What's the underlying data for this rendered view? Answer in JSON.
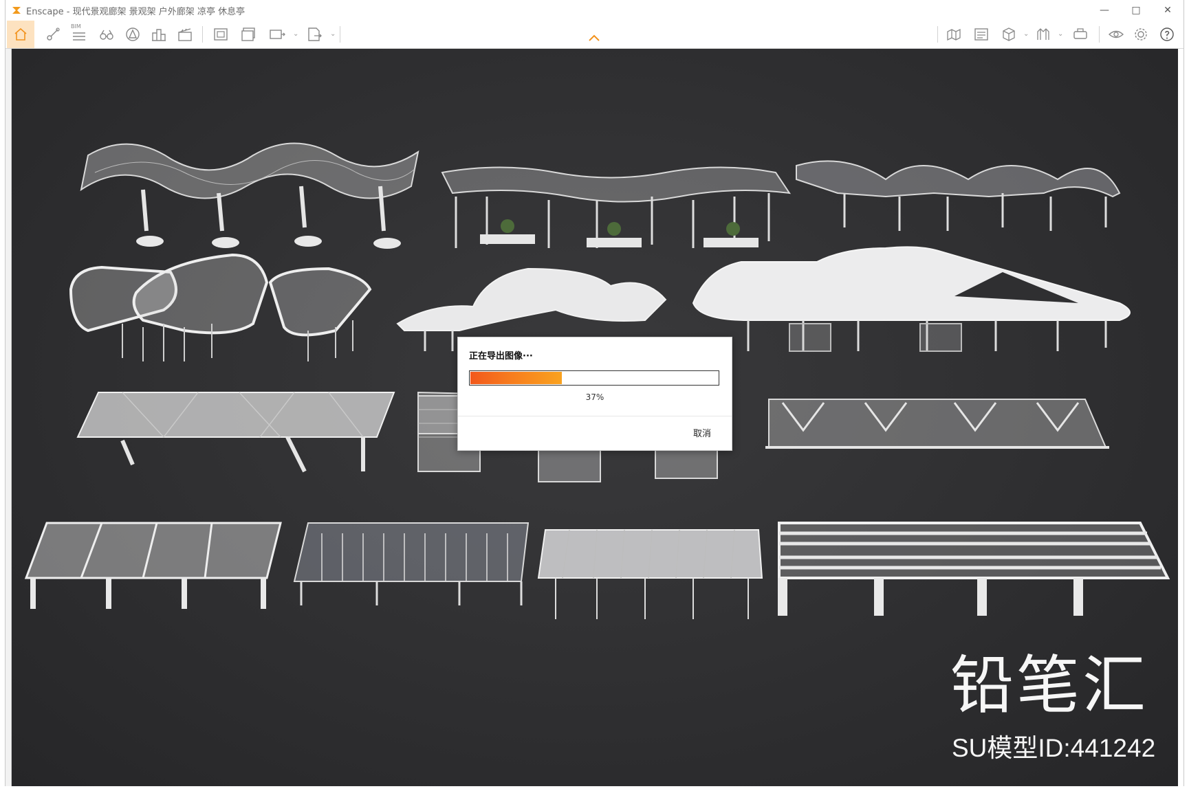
{
  "window": {
    "title": "Enscape - 现代景观廊架 景观架 户外廊架 凉亭 休息亭",
    "controls": [
      "minimize-icon",
      "maximize-icon",
      "close-icon"
    ]
  },
  "toolbar": {
    "bim_label": "BIM",
    "icons": [
      "home-icon",
      "measure-icon",
      "bim-list-icon",
      "binoculars-icon",
      "asset-library-icon",
      "buildings-icon",
      "video-editor-icon",
      "screenshot-icon",
      "batch-render-icon",
      "panorama-icon",
      "export-exe-icon",
      "site-context-icon",
      "atlas-icon",
      "cube-views-icon",
      "material-icon",
      "vr-headset-icon",
      "visual-settings-icon",
      "settings-icon",
      "help-icon"
    ],
    "accent_color": "#f2921c",
    "home_bg_color": "#fde2c0"
  },
  "export_dialog": {
    "title": "正在导出图像···",
    "progress": 0.37,
    "percent_text": "37%",
    "cancel_label": "取消"
  },
  "watermark": {
    "brand": "铅笔汇",
    "model_id": "SU模型ID:441242"
  }
}
